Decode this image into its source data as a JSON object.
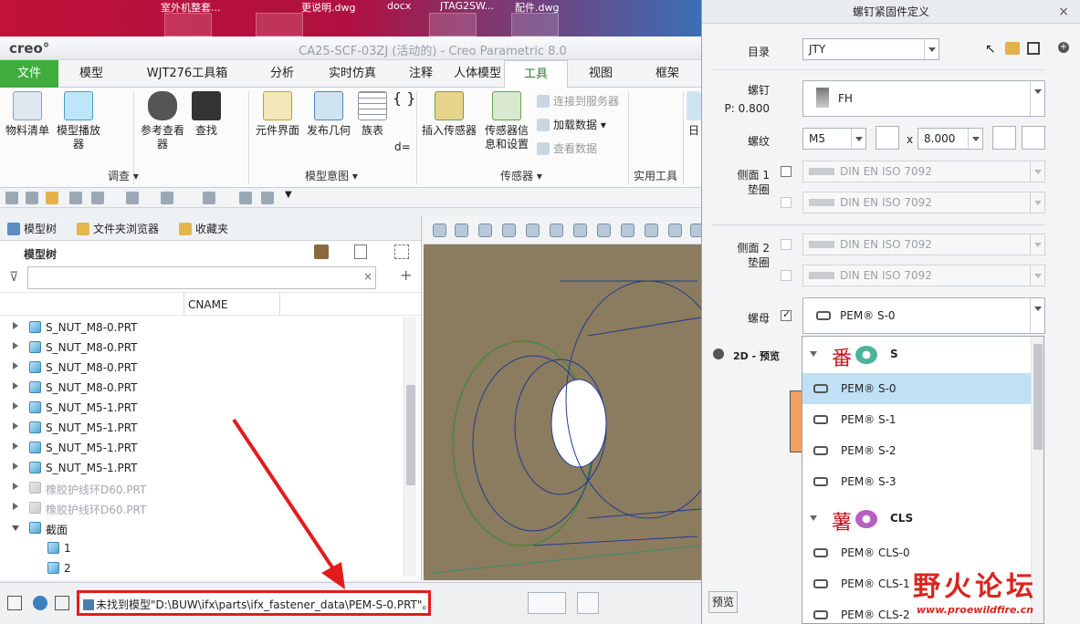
{
  "taskbar": {
    "items": [
      "室外机整套...",
      "更说明.dwg",
      "docx",
      "JTAG2SW...",
      "配件.dwg"
    ]
  },
  "window": {
    "logo": "creo°",
    "title": "CA25-SCF-03ZJ (活动的) - Creo Parametric 8.0"
  },
  "tabs": [
    "文件",
    "模型",
    "WJT276工具箱",
    "分析",
    "实时仿真",
    "注释",
    "人体模型",
    "工具",
    "视图",
    "框架"
  ],
  "active_tab": "工具",
  "ribbon": {
    "buttons": [
      "物料清单",
      "模型播放器",
      "参考查看器",
      "查找",
      "元件界面",
      "发布几何",
      "族表",
      "插入传感器",
      "传感器信息和设置",
      "日"
    ],
    "small_buttons": [
      "连接到服务器",
      "加载数据",
      "查看数据"
    ],
    "symbol": "d=",
    "groups": [
      "调查",
      "模型意图",
      "传感器",
      "实用工具"
    ]
  },
  "tree": {
    "tabs": [
      "模型树",
      "文件夹浏览器",
      "收藏夹"
    ],
    "header": "模型树",
    "column": "CNAME",
    "items": [
      {
        "label": "S_NUT_M8-0.PRT",
        "dim": false
      },
      {
        "label": "S_NUT_M8-0.PRT",
        "dim": false
      },
      {
        "label": "S_NUT_M8-0.PRT",
        "dim": false
      },
      {
        "label": "S_NUT_M8-0.PRT",
        "dim": false
      },
      {
        "label": "S_NUT_M5-1.PRT",
        "dim": false
      },
      {
        "label": "S_NUT_M5-1.PRT",
        "dim": false
      },
      {
        "label": "S_NUT_M5-1.PRT",
        "dim": false
      },
      {
        "label": "S_NUT_M5-1.PRT",
        "dim": false
      },
      {
        "label": "橡胶护线环D60.PRT",
        "dim": true
      },
      {
        "label": "橡胶护线环D60.PRT",
        "dim": true
      },
      {
        "label": "截面",
        "dim": false
      },
      {
        "label": "1",
        "dim": false
      },
      {
        "label": "2",
        "dim": false
      }
    ]
  },
  "status": {
    "message": "未找到模型\"D:\\BUW\\ifx\\parts\\ifx_fastener_data\\PEM-S-0.PRT\"。"
  },
  "dialog": {
    "title": "螺钉紧固件定义",
    "catalog_label": "目录",
    "catalog_value": "JTY",
    "screw_label": "螺钉",
    "pitch": "P: 0.800",
    "screw_value": "FH",
    "thread_label": "螺纹",
    "thread_value": "M5",
    "x_label": "x",
    "length_value": "8.000",
    "side1_label": "侧面 1\n垫圈",
    "side2_label": "侧面 2\n垫圈",
    "washer_value": "DIN EN ISO 7092",
    "nut_label": "螺母",
    "nut_value": "PEM® S-0",
    "preview_2d_label": "2D - 预览",
    "preview_button": "预览"
  },
  "nut_list": {
    "groups": [
      {
        "glyph": "番",
        "name": "S",
        "nut_color": "#4db39a",
        "items": [
          "PEM® S-0",
          "PEM® S-1",
          "PEM® S-2",
          "PEM® S-3"
        ]
      },
      {
        "glyph": "薯",
        "name": "CLS",
        "nut_color": "#b85fc2",
        "items": [
          "PEM® CLS-0",
          "PEM® CLS-1",
          "PEM® CLS-2"
        ]
      }
    ],
    "selected": "PEM® S-0"
  },
  "watermark": {
    "text": "野火论坛",
    "url": "www.proewildfire.cn"
  },
  "colors": {
    "file_tab": "#3fae3f",
    "highlight": "#e41b1b",
    "selection": "#bfe0f5",
    "viewport_bg": "#8b7b5f"
  }
}
